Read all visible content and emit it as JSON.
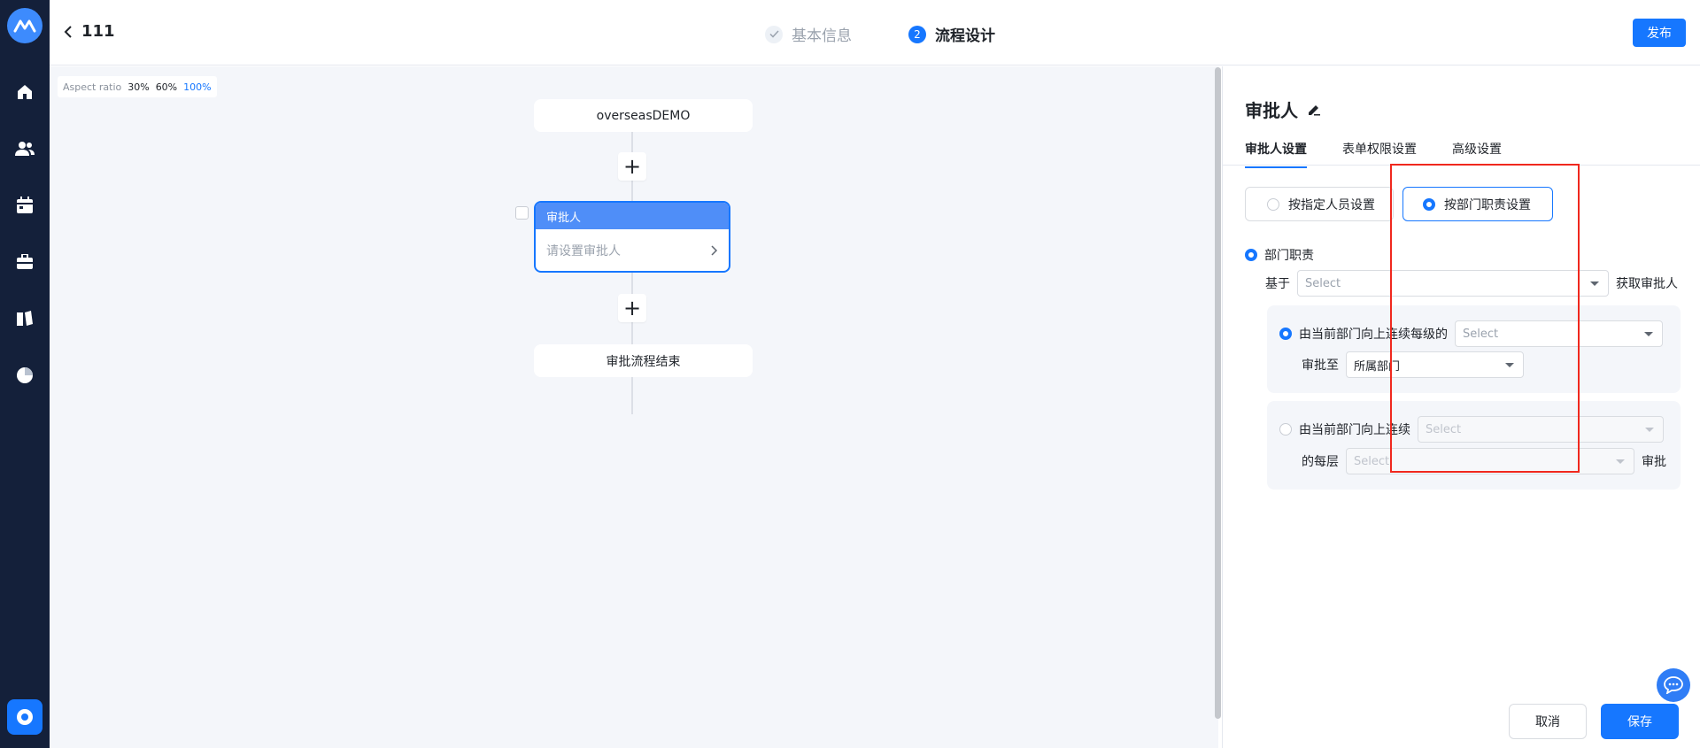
{
  "header": {
    "title": "111",
    "steps": [
      {
        "label": "基本信息"
      },
      {
        "number": "2",
        "label": "流程设计"
      }
    ],
    "publish_label": "发布"
  },
  "sidebar": {
    "icons": [
      "home-icon",
      "users-icon",
      "calendar-icon",
      "briefcase-icon",
      "book-icon",
      "pie-chart-icon"
    ]
  },
  "canvas": {
    "aspect_label": "Aspect ratio",
    "aspect_options": [
      "30%",
      "60%",
      "100%"
    ],
    "aspect_active": "100%",
    "start_node": "overseasDEMO",
    "approver_node": {
      "title": "审批人",
      "placeholder": "请设置审批人"
    },
    "end_node": "审批流程结束"
  },
  "panel": {
    "title": "审批人",
    "tabs": [
      "审批人设置",
      "表单权限设置",
      "高级设置"
    ],
    "mode_options": [
      "按指定人员设置",
      "按部门职责设置"
    ],
    "section_label": "部门职责",
    "based_on_label": "基于",
    "based_on_placeholder": "Select",
    "get_approver_label": "获取审批人",
    "option1": {
      "label": "由当前部门向上连续每级的",
      "select_placeholder": "Select",
      "approve_to_label": "审批至",
      "approve_to_value": "所属部门"
    },
    "option2": {
      "label": "由当前部门向上连续",
      "select_placeholder": "Select",
      "each_layer_label": "的每层",
      "layer_placeholder": "Select",
      "suffix": "审批"
    },
    "cancel_label": "取消",
    "save_label": "保存"
  },
  "colors": {
    "accent": "#1677ff",
    "sidebar_bg": "#14203a",
    "annotation": "#f0281e"
  }
}
